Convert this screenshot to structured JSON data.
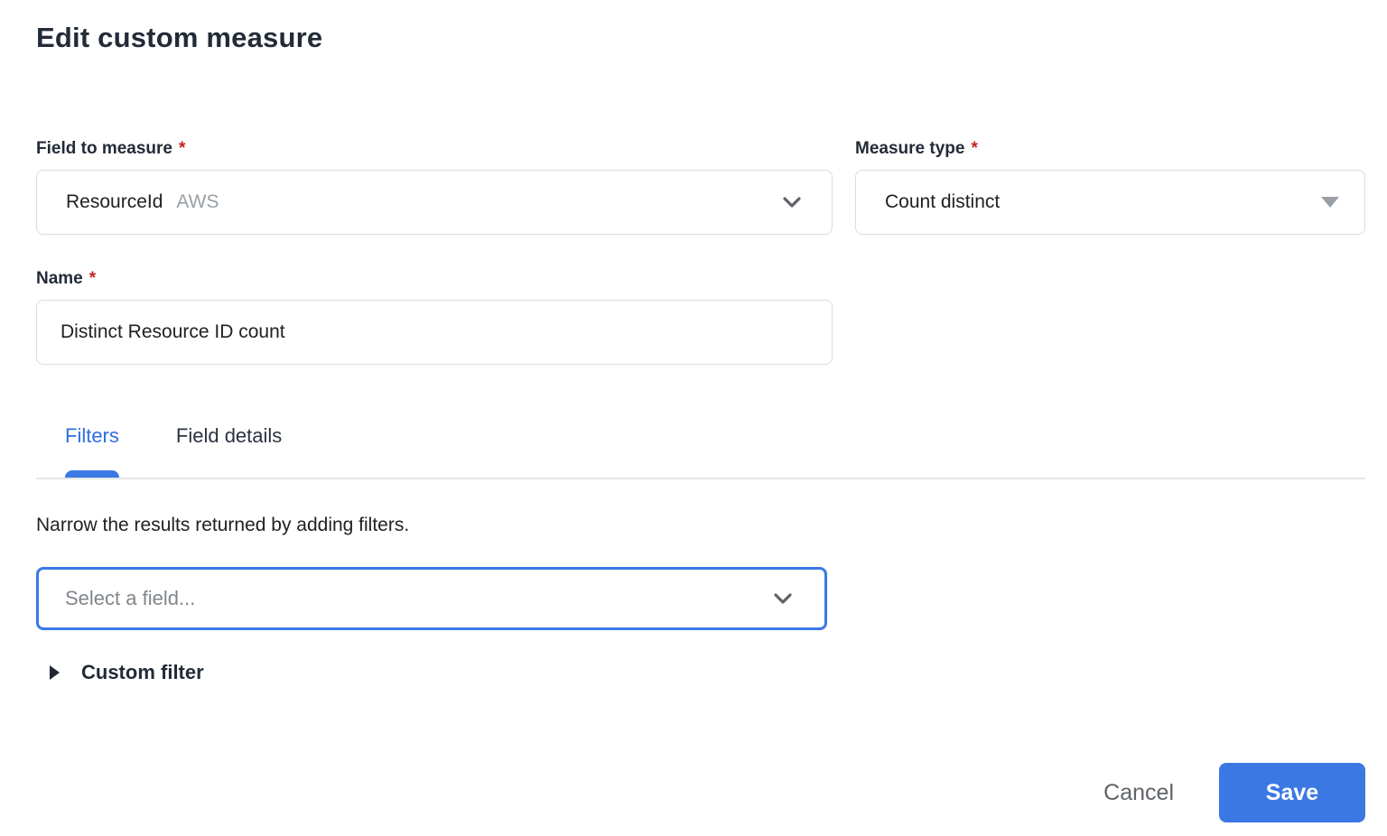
{
  "page": {
    "title": "Edit custom measure"
  },
  "form": {
    "required_marker": "*",
    "field_to_measure": {
      "label": "Field to measure",
      "value": "ResourceId",
      "value_tag": "AWS"
    },
    "measure_type": {
      "label": "Measure type",
      "value": "Count distinct"
    },
    "name": {
      "label": "Name",
      "value": "Distinct Resource ID count"
    }
  },
  "tabs": {
    "filters": "Filters",
    "field_details": "Field details"
  },
  "filters_panel": {
    "description": "Narrow the results returned by adding filters.",
    "field_select_placeholder": "Select a field...",
    "custom_filter_label": "Custom filter"
  },
  "footer": {
    "cancel": "Cancel",
    "save": "Save"
  },
  "colors": {
    "accent_blue": "#3b78e4",
    "text_dark": "#202124",
    "heading_dark": "#232b38",
    "muted_gray": "#80868b",
    "tag_gray": "#9aa0a6",
    "border_gray": "#dadce0",
    "divider_gray": "#e4e5e7",
    "required_red": "#c5221f",
    "cancel_gray": "#5f6368"
  }
}
